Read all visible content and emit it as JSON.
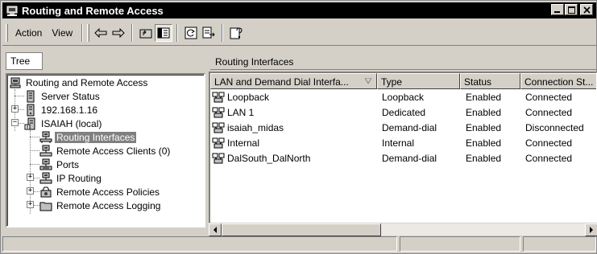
{
  "window": {
    "title": "Routing and Remote Access",
    "controls": [
      "minimize-icon",
      "maximize-icon",
      "close-icon"
    ]
  },
  "menu": {
    "action": "Action",
    "view": "View"
  },
  "toolbar_icons": [
    "back-arrow-icon",
    "forward-arrow-icon",
    "up-folder-icon",
    "show-hide-tree-icon",
    "refresh-icon",
    "export-list-icon",
    "help-icon"
  ],
  "tree": {
    "tab_label": "Tree",
    "items": [
      {
        "label": "Routing and Remote Access",
        "icon": "rras-root-icon"
      },
      {
        "label": "Server Status",
        "icon": "server-status-icon"
      },
      {
        "label": "192.168.1.16",
        "icon": "server-icon"
      },
      {
        "label": "ISAIAH (local)",
        "icon": "server-local-icon"
      },
      {
        "label": "Routing Interfaces",
        "icon": "routing-interfaces-icon",
        "selected": true
      },
      {
        "label": "Remote Access Clients (0)",
        "icon": "remote-clients-icon"
      },
      {
        "label": "Ports",
        "icon": "ports-icon"
      },
      {
        "label": "IP Routing",
        "icon": "ip-routing-icon"
      },
      {
        "label": "Remote Access Policies",
        "icon": "policies-icon"
      },
      {
        "label": "Remote Access Logging",
        "icon": "folder-icon"
      }
    ]
  },
  "details": {
    "header": "Routing Interfaces",
    "columns": [
      "LAN and Demand Dial Interfa...",
      "Type",
      "Status",
      "Connection St..."
    ],
    "rows": [
      {
        "name": "Loopback",
        "type": "Loopback",
        "status": "Enabled",
        "connection": "Connected"
      },
      {
        "name": "LAN 1",
        "type": "Dedicated",
        "status": "Enabled",
        "connection": "Connected"
      },
      {
        "name": "isaiah_midas",
        "type": "Demand-dial",
        "status": "Enabled",
        "connection": "Disconnected"
      },
      {
        "name": "Internal",
        "type": "Internal",
        "status": "Enabled",
        "connection": "Connected"
      },
      {
        "name": "DalSouth_DalNorth",
        "type": "Demand-dial",
        "status": "Enabled",
        "connection": "Connected"
      }
    ]
  },
  "colors": {
    "titlebar": "#000000",
    "chrome": "#d4d0c8",
    "selection": "#808080"
  }
}
